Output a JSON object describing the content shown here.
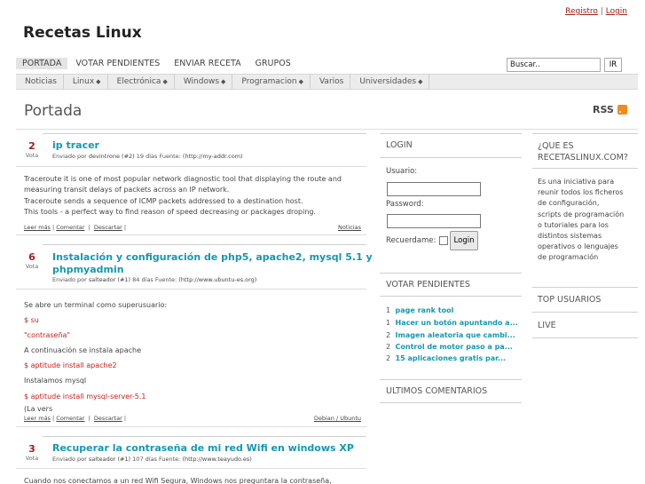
{
  "header": {
    "register_label": "Registro",
    "separator": "|",
    "login_label": "Login",
    "site_title": "Recetas Linux"
  },
  "main_nav": [
    "PORTADA",
    "VOTAR PENDIENTES",
    "ENVIAR RECETA",
    "GRUPOS"
  ],
  "search": {
    "placeholder": "Buscar..",
    "button": "IR"
  },
  "sub_nav": [
    {
      "label": "Noticias",
      "dropdown": false
    },
    {
      "label": "Linux",
      "dropdown": true
    },
    {
      "label": "Electrónica",
      "dropdown": true
    },
    {
      "label": "Windows",
      "dropdown": true
    },
    {
      "label": "Programacion",
      "dropdown": true
    },
    {
      "label": "Varios",
      "dropdown": false
    },
    {
      "label": "Universidades",
      "dropdown": true
    }
  ],
  "page": {
    "title": "Portada",
    "rss": "RSS"
  },
  "posts": [
    {
      "votes": "2",
      "vote_label": "Vota",
      "title": "ip tracer",
      "meta_prefix": "Enviado por",
      "author": "devintrone (#2)",
      "meta_mid": "19 días Fuente:",
      "source": "(http://my-addr.com)",
      "body": [
        "Traceroute it is one of most popular network diagnostic tool that displaying the route and",
        "measuring transit delays of packets across an IP network.",
        "Traceroute sends a sequence of ICMP packets addressed to a destination host.",
        "This tools - a perfect way to find reason of speed decreasing or packages droping."
      ],
      "read_more": "Leer más",
      "comment": "Comentar",
      "share": "Descartar",
      "category": "Noticias"
    },
    {
      "votes": "6",
      "vote_label": "Vota",
      "title_line1": "Instalación y configuración de php5, apache2, mysql 5.1 y",
      "title_line2": "phpmyadmin",
      "meta_prefix": "Enviado por",
      "author": "salteador (#1)",
      "meta_mid": "84 días Fuente:",
      "source": "(http://www.ubuntu-es.org)",
      "body": [
        "Se abre un terminal como superusuario:",
        "$ su",
        "\"contraseña\"",
        "A continuación se instala apache",
        "$ aptitude install apache2",
        "Instalamos mysql",
        "$ aptitude install mysql-server-5.1",
        "(La vers"
      ],
      "read_more": "Leer más",
      "comment": "Comentar",
      "share": "Descartar",
      "category": "Debian / Ubuntu"
    },
    {
      "votes": "3",
      "vote_label": "Vota",
      "title": "Recuperar la contraseña de mi red Wifi en windows XP",
      "meta_prefix": "Enviado por",
      "author": "salteador (#1)",
      "meta_mid": "107 días Fuente:",
      "source": "(http://www.teayudo.es)",
      "body": [
        "Cuando nos conectamos a un red Wifi Segura, Windows nos preguntara la contraseña,"
      ]
    }
  ],
  "login": {
    "heading": "LOGIN",
    "user_label": "Usuario:",
    "password_label": "Password:",
    "remember_label": "Recuerdame:",
    "button": "Login"
  },
  "pending": {
    "heading": "VOTAR PENDIENTES",
    "items": [
      {
        "count": "1",
        "title": "page rank tool"
      },
      {
        "count": "1",
        "title": "Hacer un botón apuntando a..."
      },
      {
        "count": "2",
        "title": "Imagen aleatoria que cambi..."
      },
      {
        "count": "2",
        "title": "Control de motor paso a pa..."
      },
      {
        "count": "2",
        "title": "15 aplicaciones gratis par..."
      }
    ]
  },
  "latest_comments": {
    "heading": "ULTIMOS COMENTARIOS"
  },
  "about": {
    "heading_line1": "¿QUE ES",
    "heading_line2": "RECETASLINUX.COM?",
    "text": "Es una iniciativa para reunir todos los ficheros de configuración, scripts de programación o tutoriales para los distintos sistemas operativos o lenguajes de programación"
  },
  "top_users": {
    "heading": "TOP USUARIOS"
  },
  "live": {
    "heading": "LIVE"
  },
  "colors": {
    "accent_red": "#a0201d",
    "title_teal": "#1598b0",
    "rss_orange": "#f08c1e"
  }
}
